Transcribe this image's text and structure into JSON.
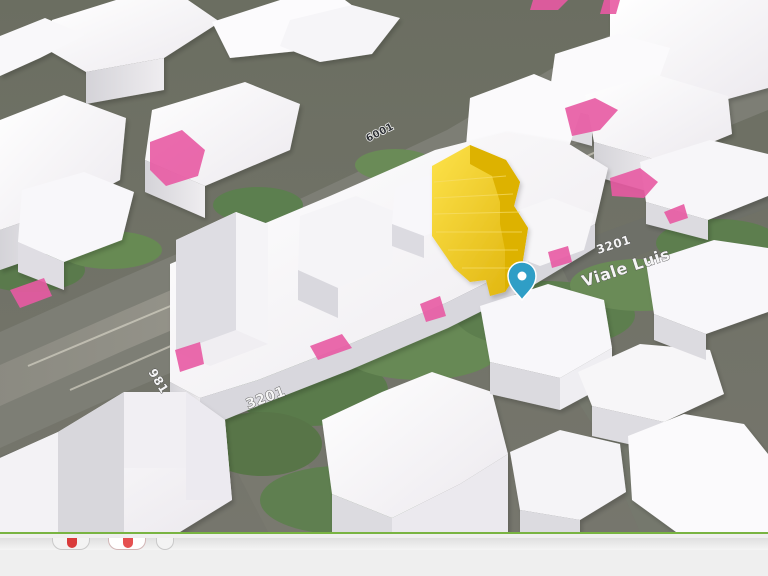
{
  "map": {
    "street_labels": {
      "upper_number": "6001",
      "right_number": "3201",
      "right_name": "Viale Luis",
      "left_number": "981",
      "bottom_number": "3201"
    },
    "selected_building": "yellow highlighted building",
    "marker": "location marker"
  },
  "toolbar": {
    "buttons": [
      {
        "name": "map-control-1"
      },
      {
        "name": "map-control-2"
      },
      {
        "name": "map-control-3"
      }
    ]
  },
  "colors": {
    "building": "#f4f1f4",
    "building_shadow": "#d9d8de",
    "pink": "#e85aa3",
    "highlight": "#f3c71f",
    "trees": "#5d7e4e",
    "road": "#8b8a80",
    "marker": "#2f9ec6"
  },
  "icons": {
    "marker": "location-pin-icon"
  }
}
